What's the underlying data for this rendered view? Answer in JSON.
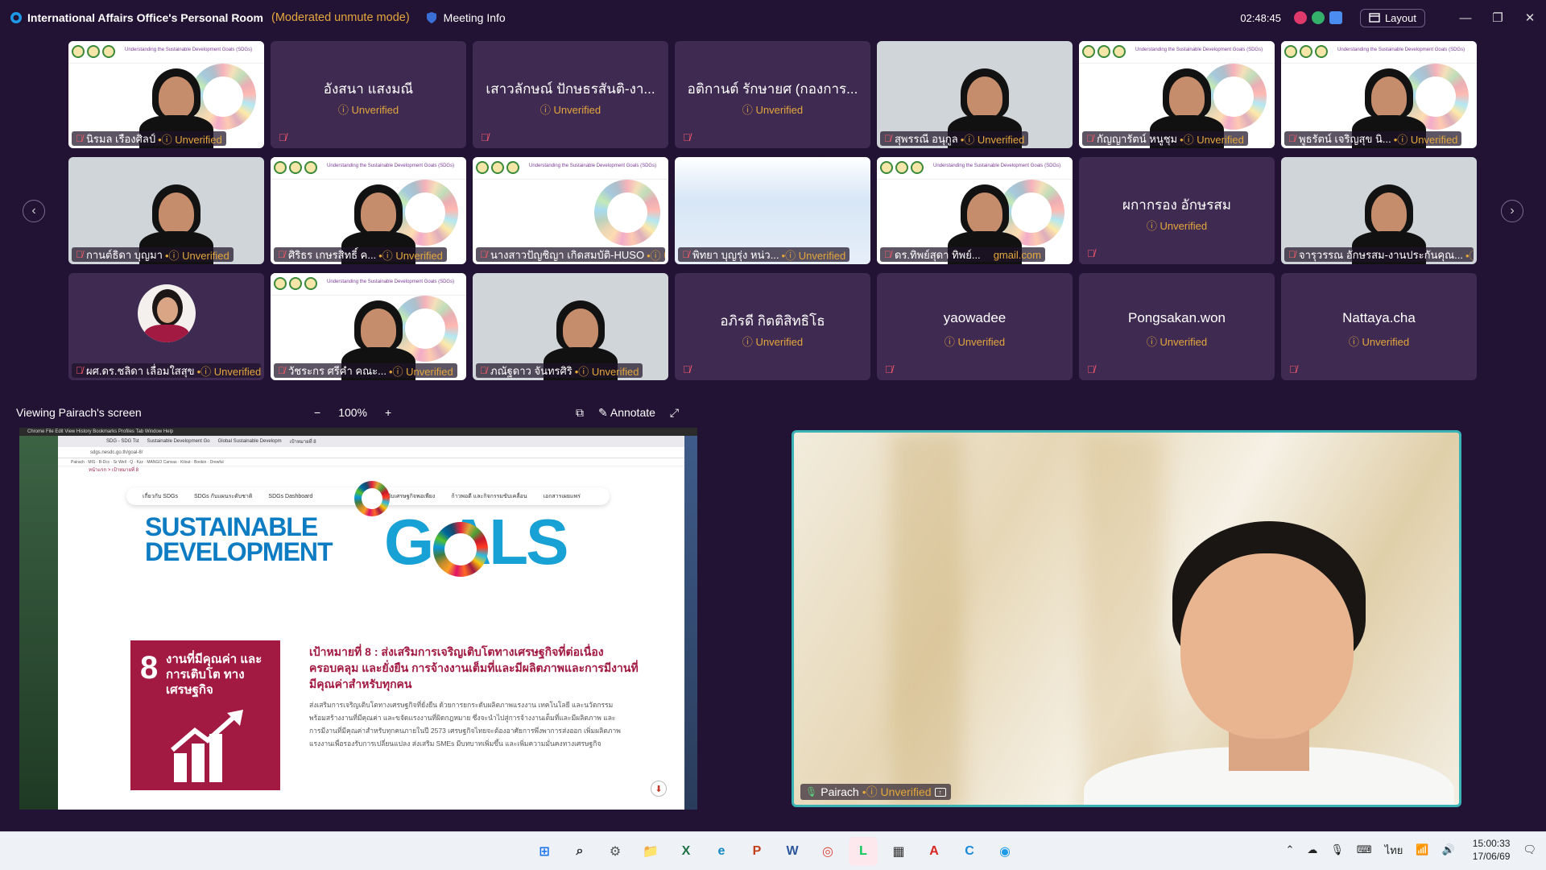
{
  "titlebar": {
    "room": "International Affairs Office's Personal Room",
    "mode": "(Moderated unmute mode)",
    "meeting_info": "Meeting Info",
    "timer": "02:48:45",
    "layout": "Layout"
  },
  "unverified": "Unverified",
  "tiles": [
    {
      "name": "นิรมล เรืองศิลป์",
      "type": "video"
    },
    {
      "name": "อังสนา แสงมณี",
      "type": "name"
    },
    {
      "name": "เสาวลักษณ์ ปักษธรสันติ-งา...",
      "type": "name"
    },
    {
      "name": "อติกานต์ รักษายศ (กองการ...",
      "type": "name"
    },
    {
      "name": "สุพรรณี อนุกูล",
      "type": "video"
    },
    {
      "name": "กัญญารัตน์ หนูชุม",
      "type": "video"
    },
    {
      "name": "พูธรัตน์ เจริญสุข นิ...",
      "type": "video"
    },
    {
      "name": "กานต์ธิดา บุญมา",
      "type": "video"
    },
    {
      "name": "ศิริธร เกษรสิทธิ์ ค...",
      "type": "video"
    },
    {
      "name": "นางสาวปัญชิญา เกิดสมบัติ-HUSO",
      "type": "video"
    },
    {
      "name": "พิทยา บุญรุ่ง หน่ว...",
      "type": "video"
    },
    {
      "name": "ดร.ทิพย์สุดา ทิพย์...",
      "type": "video",
      "extra": "gmail.com"
    },
    {
      "name": "ผกากรอง อักษรสม",
      "type": "name"
    },
    {
      "name": "จารุวรรณ อักษรสม-งานประกันคุณ...",
      "type": "video"
    },
    {
      "name": "ผศ.ดร.ชลิดา เลื่อมใสสุข",
      "type": "avatar"
    },
    {
      "name": "วัชระกร ศรีคำ คณะ...",
      "type": "video"
    },
    {
      "name": "ภณัฐดาว จันทรศิริ",
      "type": "video"
    },
    {
      "name": "อภิรดี กิตติสิทธิโธ",
      "type": "name"
    },
    {
      "name": "yaowadee",
      "type": "name"
    },
    {
      "name": "Pongsakan.won",
      "type": "name"
    },
    {
      "name": "Nattaya.cha",
      "type": "name"
    }
  ],
  "share": {
    "viewing": "Viewing Pairach's screen",
    "zoom": "100%",
    "annotate": "Annotate",
    "crumb": "หน้าแรก > เป้าหมายที่ 8",
    "url": "sdgs.nesdc.go.th/goal-8/",
    "site_nav": [
      "เกี่ยวกับ SDGs",
      "SDGs กับแผนระดับชาติ",
      "SDGs Dashboard",
      "SDGs กับเศรษฐกิจพอเพียง",
      "ก้าวพอดี และกิจกรรมขับเคลื่อน",
      "เอกสารเผยแพร่"
    ],
    "sdg_title_1": "SUSTAINABLE",
    "sdg_title_2": "DEVELOPMENT",
    "goals_word": "G ALS",
    "goal_number": "8",
    "goal_short": "งานที่มีคุณค่า และการเติบโต ทางเศรษฐกิจ",
    "goal_head": "เป้าหมายที่ 8 : ส่งเสริมการเจริญเติบโตทางเศรษฐกิจที่ต่อเนื่อง ครอบคลุม และยั่งยืน การจ้างงานเต็มที่และมีผลิตภาพและการมีงานที่มีคุณค่าสำหรับทุกคน",
    "goal_body": "ส่งเสริมการเจริญเติบโตทางเศรษฐกิจที่ยั่งยืน ด้วยการยกระดับผลิตภาพแรงงาน เทคโนโลยี และนวัตกรรม พร้อมสร้างงานที่มีคุณค่า และขจัดแรงงานที่ผิดกฎหมาย ซึ่งจะนำไปสู่การจ้างงานเต็มที่และมีผลิตภาพ และการมีงานที่มีคุณค่าสำหรับทุกคนภายในปี 2573 เศรษฐกิจไทยจะต้องอาศัยการพึ่งพาการส่งออก เพิ่มผลิตภาพแรงงานเพื่อรองรับการเปลี่ยนแปลง ส่งเสริม SMEs มีบทบาทเพิ่มขึ้น และเพิ่มความมั่นคงทางเศรษฐกิจ"
  },
  "speaker": {
    "name": "Pairach"
  },
  "taskbar": {
    "icons": [
      "start-icon",
      "search-icon",
      "settings-icon",
      "folder-icon",
      "excel-icon",
      "edge-icon",
      "powerpoint-icon",
      "word-icon",
      "chrome-icon",
      "line-icon",
      "calculator-icon",
      "acrobat-icon",
      "copilot-icon",
      "webex-icon"
    ],
    "lang": "ไทย",
    "time": "15:00:33",
    "date": "17/06/69"
  }
}
